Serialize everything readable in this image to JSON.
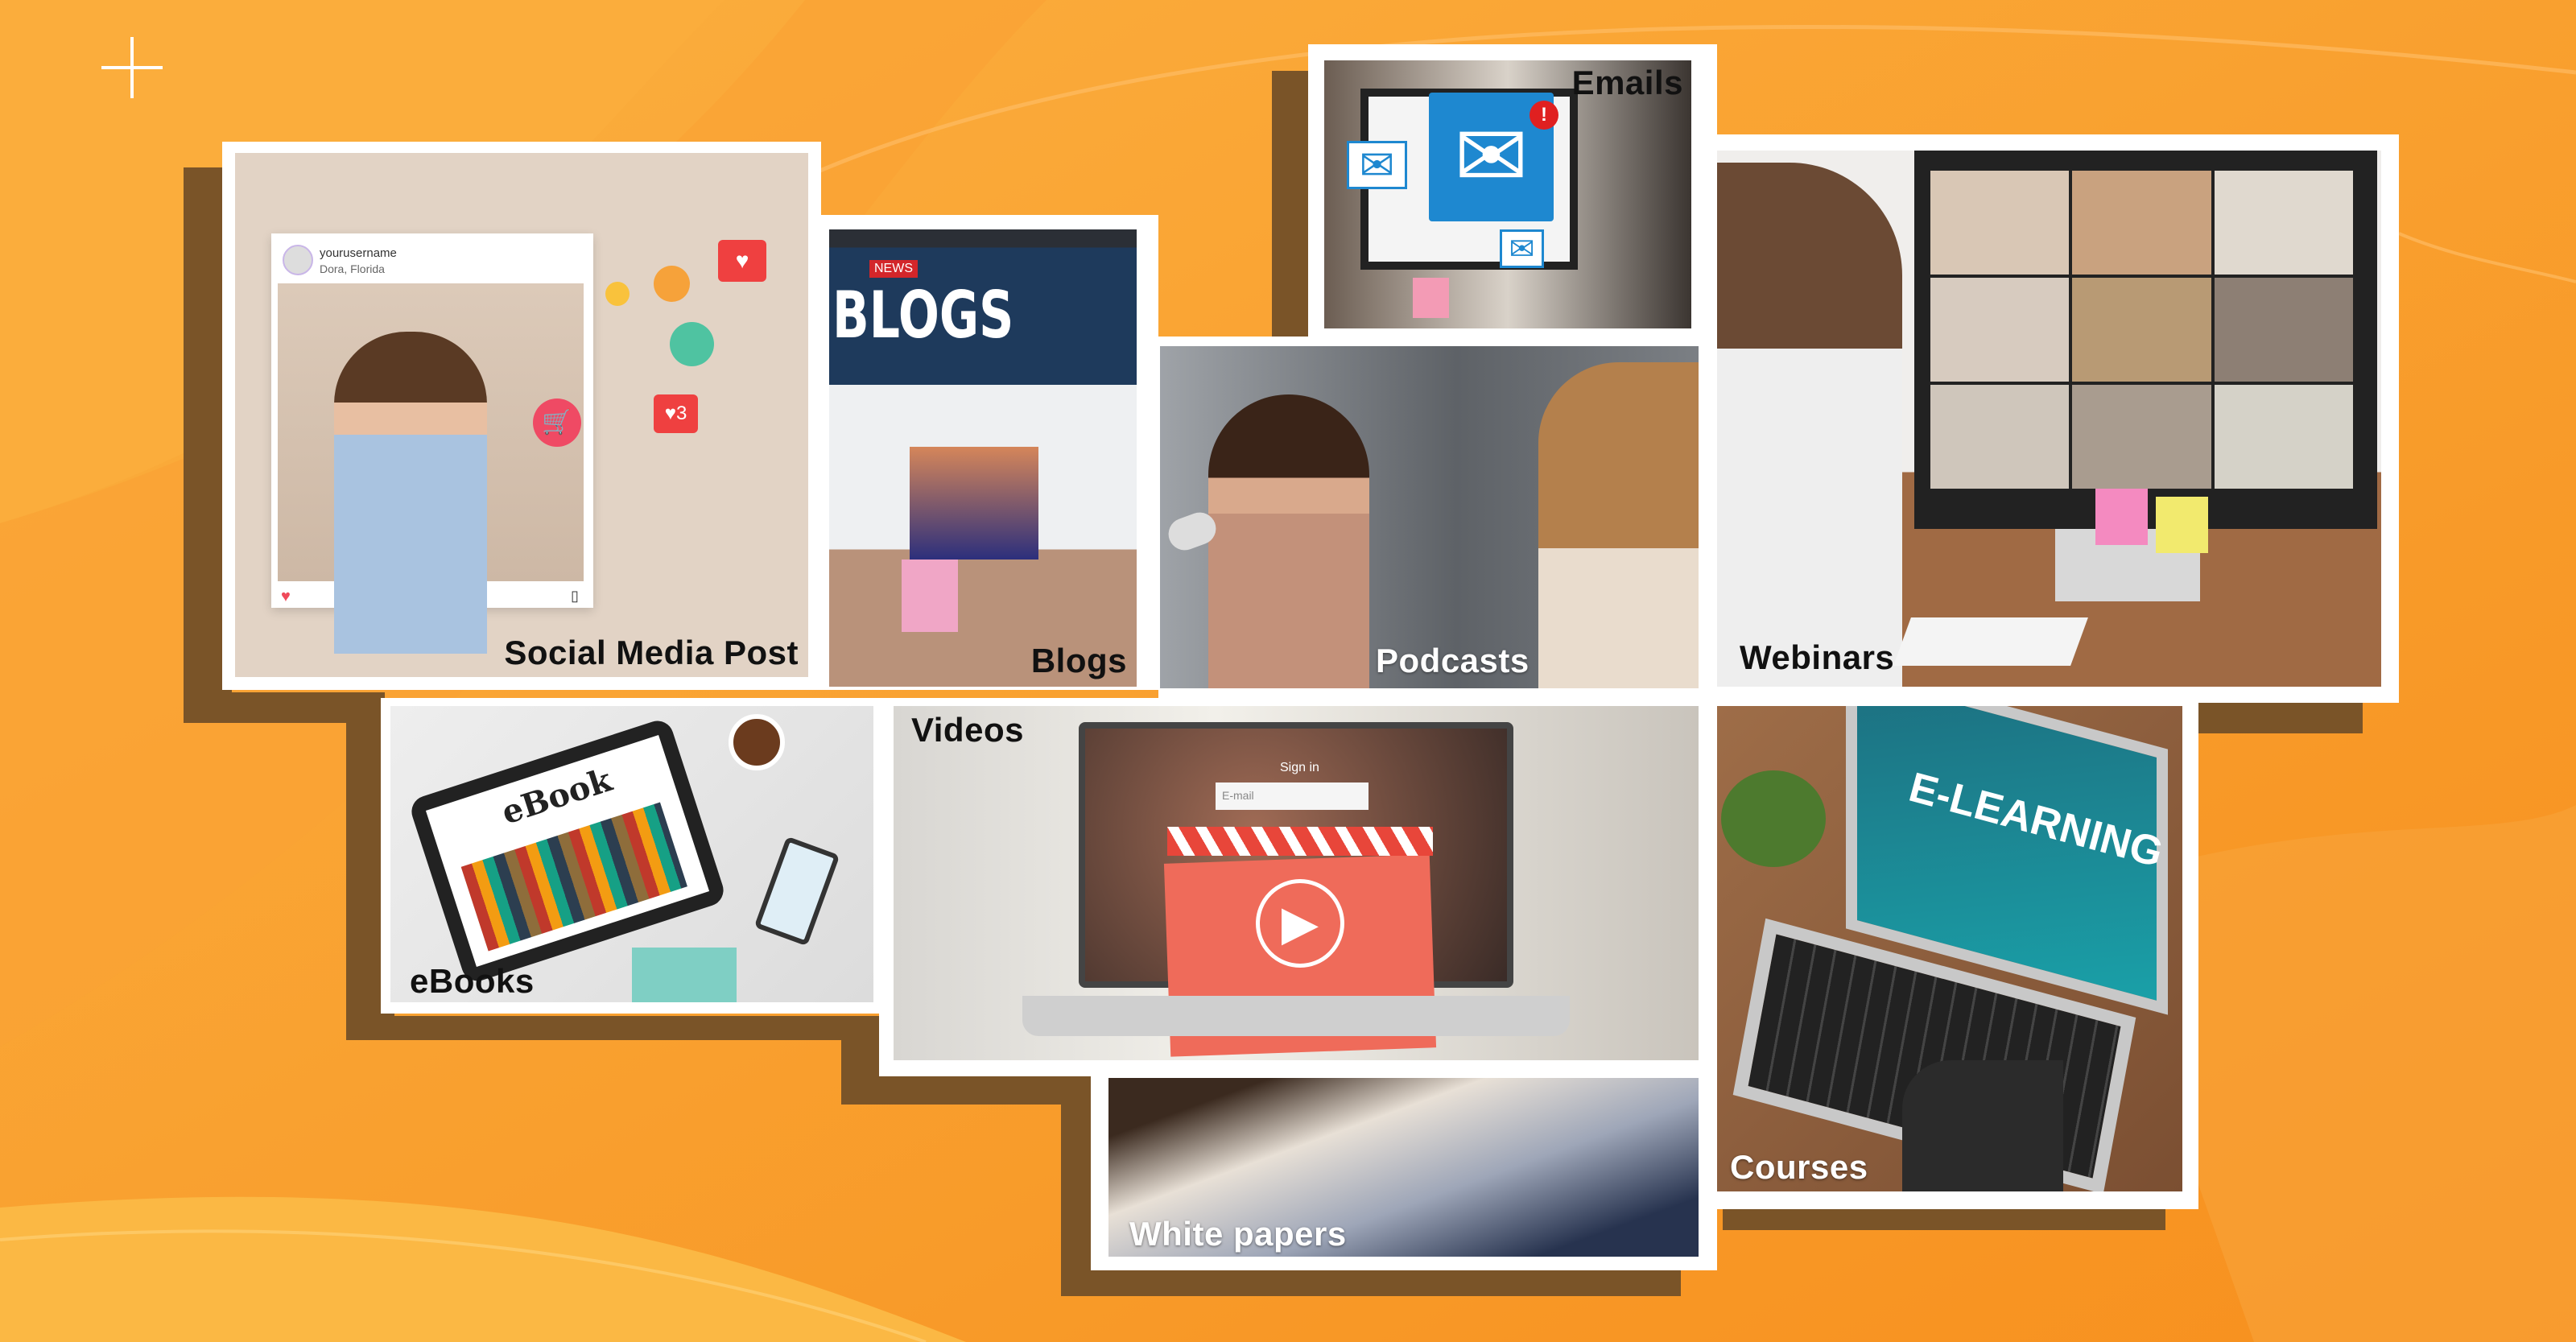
{
  "colors": {
    "background": "#f8962a",
    "shadow": "#7a5428",
    "frame": "#ffffff"
  },
  "decor": {
    "icon": "plus-icon"
  },
  "tiles": [
    {
      "id": "social",
      "label": "Social Media Post",
      "post_username": "yourusername",
      "post_location": "Dora, Florida"
    },
    {
      "id": "blogs",
      "label": "Blogs",
      "screen_title": "BLOGS",
      "screen_tag": "NEWS"
    },
    {
      "id": "emails",
      "label": "Emails",
      "icon": "envelope-icon"
    },
    {
      "id": "podcasts",
      "label": "Podcasts"
    },
    {
      "id": "webinars",
      "label": "Webinars"
    },
    {
      "id": "ebooks",
      "label": "eBooks",
      "screen_title": "eBook"
    },
    {
      "id": "videos",
      "label": "Videos",
      "screen_signin": "Sign in",
      "screen_email": "E-mail",
      "icon": "play-icon"
    },
    {
      "id": "whitepapers",
      "label": "White papers"
    },
    {
      "id": "courses",
      "label": "Courses",
      "screen_title": "E-LEARNING"
    }
  ]
}
